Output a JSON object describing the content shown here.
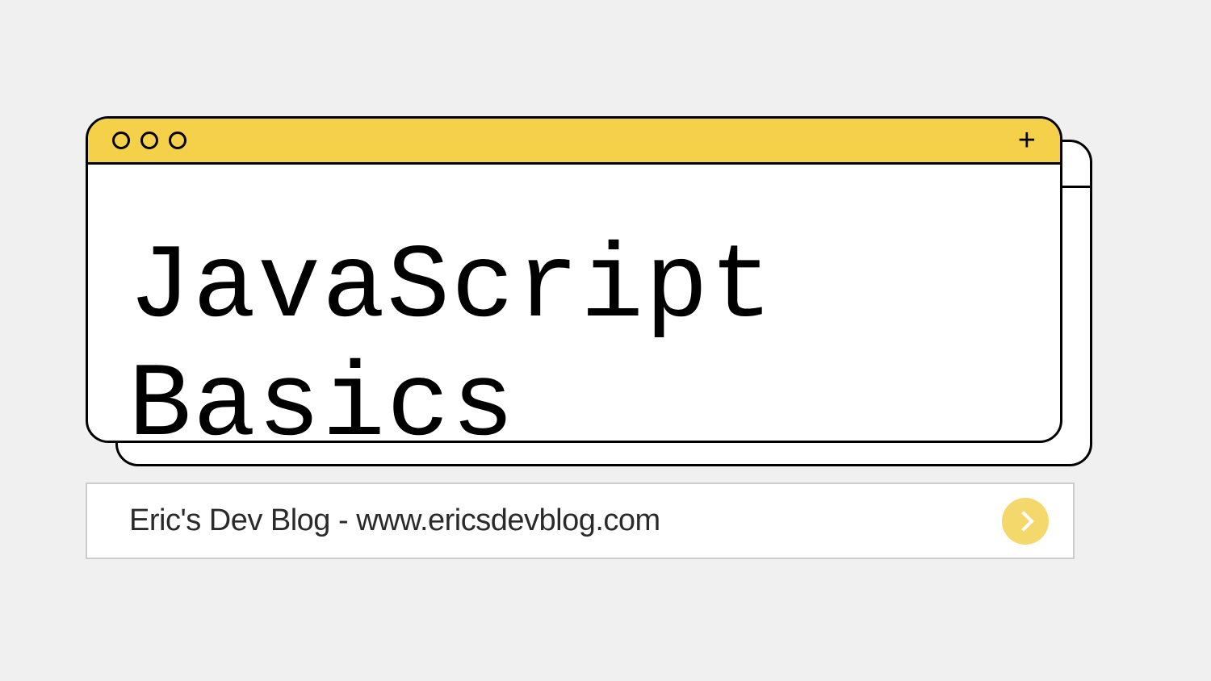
{
  "window": {
    "title": "JavaScript Basics"
  },
  "footer": {
    "text": "Eric's Dev Blog - www.ericsdevblog.com"
  },
  "colors": {
    "titlebar": "#f5d149",
    "go_button": "#f5d86b",
    "background": "#f0f0f0"
  }
}
